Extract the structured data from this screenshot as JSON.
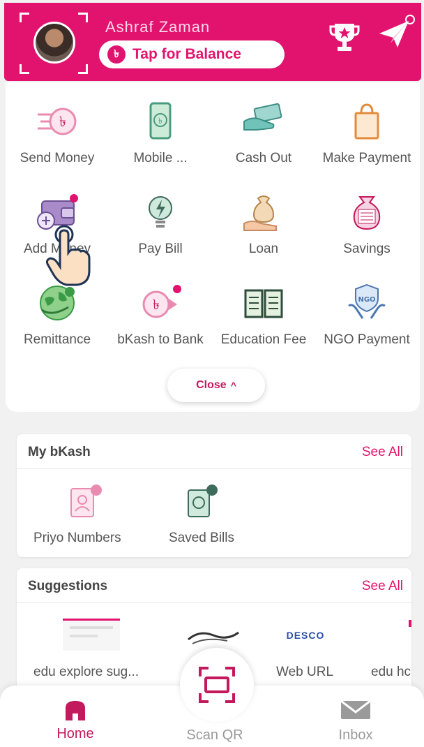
{
  "header": {
    "user_name": "Ashraf Zaman",
    "balance_label": "Tap for Balance",
    "taka_symbol": "৳"
  },
  "services": [
    {
      "label": "Send Money",
      "icon": "send-money-icon"
    },
    {
      "label": "Mobile ...",
      "icon": "mobile-recharge-icon"
    },
    {
      "label": "Cash Out",
      "icon": "cash-out-icon"
    },
    {
      "label": "Make Payment",
      "icon": "shopping-bag-icon"
    },
    {
      "label": "Add Money",
      "icon": "wallet-add-icon"
    },
    {
      "label": "Pay Bill",
      "icon": "bulb-icon"
    },
    {
      "label": "Loan",
      "icon": "loan-icon"
    },
    {
      "label": "Savings",
      "icon": "savings-icon"
    },
    {
      "label": "Remittance",
      "icon": "globe-icon"
    },
    {
      "label": "bKash to Bank",
      "icon": "taka-arrow-icon"
    },
    {
      "label": "Education Fee",
      "icon": "book-icon"
    },
    {
      "label": "NGO Payment",
      "icon": "ngo-icon"
    }
  ],
  "close_button": {
    "label": "Close"
  },
  "my_bkash": {
    "title": "My bKash",
    "see_all": "See All",
    "items": [
      {
        "label": "Priyo Numbers",
        "icon": "priyo-numbers-icon"
      },
      {
        "label": "Saved Bills",
        "icon": "saved-bills-icon"
      }
    ]
  },
  "suggestions": {
    "title": "Suggestions",
    "see_all": "See All",
    "items": [
      {
        "label": "edu explore sug..."
      },
      {
        "label": ""
      },
      {
        "label": "Web URL",
        "logo_text": "DESCO"
      },
      {
        "label": "edu hc"
      }
    ]
  },
  "bottom_nav": {
    "home": "Home",
    "scan": "Scan QR",
    "inbox": "Inbox"
  },
  "colors": {
    "brand": "#e2136e",
    "muted": "#9a9a9a"
  }
}
